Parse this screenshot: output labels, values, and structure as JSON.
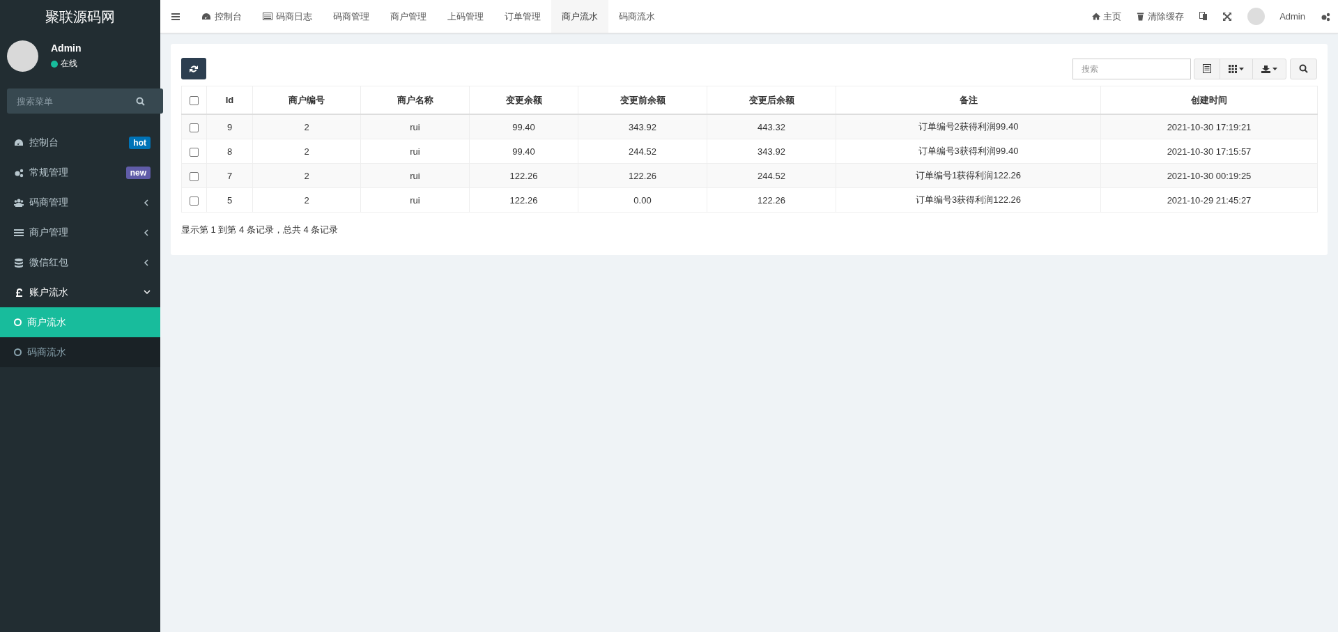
{
  "sidebar": {
    "logo": "聚联源码网",
    "user": {
      "name": "Admin",
      "status": "在线"
    },
    "search": {
      "placeholder": "搜索菜单"
    },
    "menu": [
      {
        "kind": "link",
        "label": "控制台",
        "badge": {
          "text": "hot",
          "color": "#0073b7"
        }
      },
      {
        "kind": "link",
        "label": "常规管理",
        "badge": {
          "text": "new",
          "color": "#605ca8"
        }
      },
      {
        "kind": "group",
        "label": "码商管理",
        "expanded": false
      },
      {
        "kind": "group",
        "label": "商户管理",
        "expanded": false
      },
      {
        "kind": "group",
        "label": "微信红包",
        "expanded": false
      },
      {
        "kind": "group",
        "label": "账户流水",
        "expanded": true,
        "children": [
          {
            "label": "商户流水",
            "selected": true
          },
          {
            "label": "码商流水",
            "selected": false
          }
        ]
      }
    ]
  },
  "topbar": {
    "tabs": [
      {
        "label": "控制台",
        "selected": false
      },
      {
        "label": "码商日志",
        "selected": false
      },
      {
        "label": "码商管理",
        "selected": false
      },
      {
        "label": "商户管理",
        "selected": false
      },
      {
        "label": "上码管理",
        "selected": false
      },
      {
        "label": "订单管理",
        "selected": false
      },
      {
        "label": "商户流水",
        "selected": true
      },
      {
        "label": "码商流水",
        "selected": false
      }
    ],
    "links": [
      "主页",
      "清除缓存"
    ],
    "user": "Admin"
  },
  "toolbar": {
    "search": {
      "placeholder": "搜索"
    }
  },
  "table": {
    "select_all": {
      "checked": false
    },
    "columns": [
      "Id",
      "商户编号",
      "商户名称",
      "变更余额",
      "变更前余额",
      "变更后余额",
      "备注",
      "创建时间"
    ],
    "rows": [
      {
        "checked": false,
        "cells": [
          "9",
          "2",
          "rui",
          "99.40",
          "343.92",
          "443.32",
          "订单编号2获得利润99.40",
          "2021-10-30 17:19:21"
        ]
      },
      {
        "checked": false,
        "cells": [
          "8",
          "2",
          "rui",
          "99.40",
          "244.52",
          "343.92",
          "订单编号3获得利润99.40",
          "2021-10-30 17:15:57"
        ]
      },
      {
        "checked": false,
        "cells": [
          "7",
          "2",
          "rui",
          "122.26",
          "122.26",
          "244.52",
          "订单编号1获得利润122.26",
          "2021-10-30 00:19:25"
        ]
      },
      {
        "checked": false,
        "cells": [
          "5",
          "2",
          "rui",
          "122.26",
          "0.00",
          "122.26",
          "订单编号3获得利润122.26",
          "2021-10-29 21:45:27"
        ]
      }
    ],
    "footer": "显示第 1 到第 4 条记录，总共 4 条记录"
  }
}
